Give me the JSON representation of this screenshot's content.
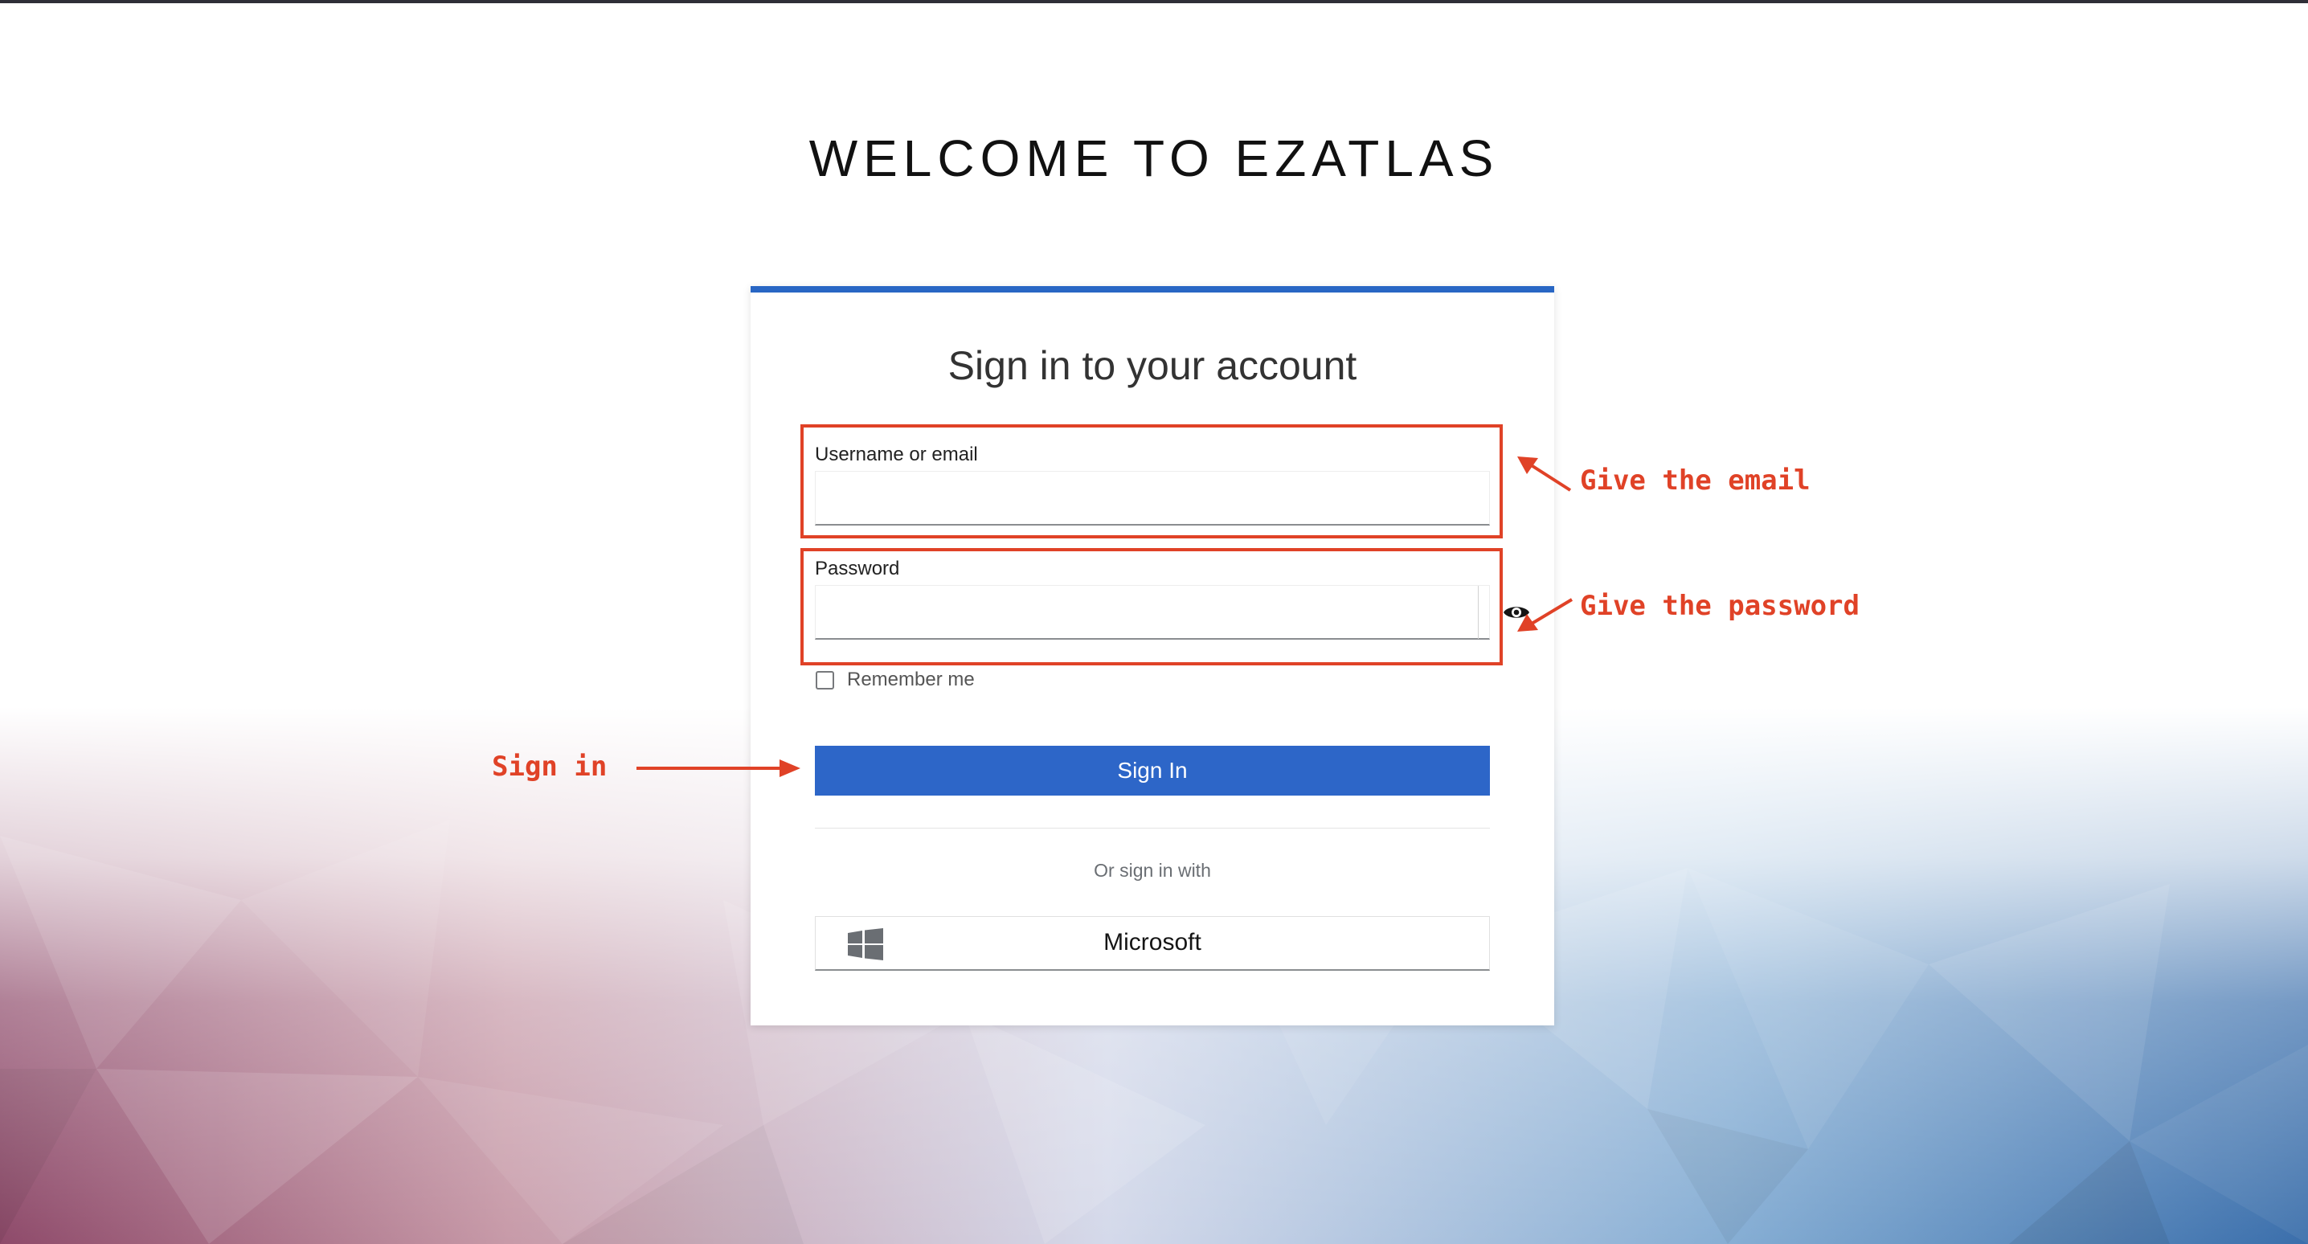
{
  "page": {
    "welcome_title": "WELCOME TO EZATLAS"
  },
  "login": {
    "card_title": "Sign in to your account",
    "username_label": "Username or email",
    "username_value": "",
    "password_label": "Password",
    "password_value": "",
    "remember_label": "Remember me",
    "remember_checked": false,
    "signin_label": "Sign In",
    "or_text": "Or sign in with",
    "provider_label": "Microsoft"
  },
  "annotations": {
    "email_note": "Give the email",
    "password_note": "Give the password",
    "signin_note": "Sign in"
  },
  "icons": {
    "show_password": "eye-icon",
    "provider": "windows-icon"
  },
  "colors": {
    "accent": "#2d66c8",
    "annotation": "#e04227",
    "card_top_border": "#2866c4"
  }
}
